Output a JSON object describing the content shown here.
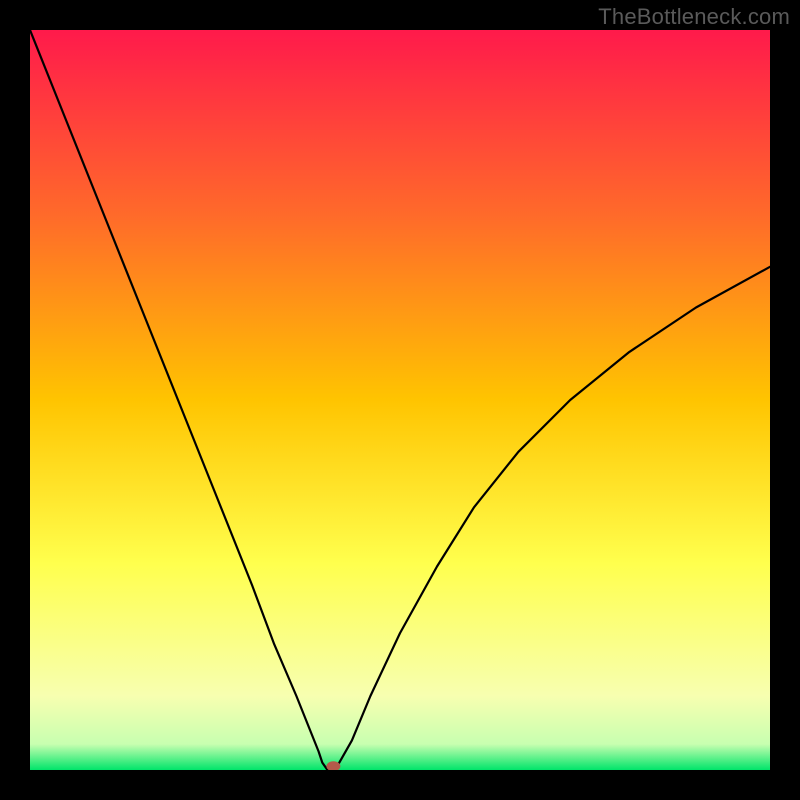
{
  "watermark": "TheBottleneck.com",
  "chart_data": {
    "type": "line",
    "title": "",
    "xlabel": "",
    "ylabel": "",
    "xlim": [
      0,
      100
    ],
    "ylim": [
      0,
      100
    ],
    "grid": false,
    "legend": false,
    "background_gradient": {
      "stops": [
        {
          "offset": 0.0,
          "color": "#ff1a4b"
        },
        {
          "offset": 0.25,
          "color": "#ff6a2a"
        },
        {
          "offset": 0.5,
          "color": "#ffc400"
        },
        {
          "offset": 0.72,
          "color": "#ffff4d"
        },
        {
          "offset": 0.9,
          "color": "#f7ffb0"
        },
        {
          "offset": 0.965,
          "color": "#c8ffb0"
        },
        {
          "offset": 1.0,
          "color": "#00e56a"
        }
      ]
    },
    "series": [
      {
        "name": "bottleneck-curve",
        "x": [
          0,
          5,
          10,
          15,
          20,
          25,
          30,
          33,
          36,
          38,
          39,
          39.5,
          40.2,
          41.0,
          41.8,
          43.5,
          46,
          50,
          55,
          60,
          66,
          73,
          81,
          90,
          100
        ],
        "y": [
          100,
          87.5,
          75,
          62.5,
          50,
          37.5,
          25,
          17,
          10,
          5,
          2.5,
          1.0,
          0.0,
          0.0,
          1.0,
          4.0,
          10,
          18.5,
          27.5,
          35.5,
          43,
          50,
          56.5,
          62.5,
          68
        ],
        "color": "#000000",
        "width": 2.2
      }
    ],
    "marker": {
      "name": "optimal-point",
      "x": 41,
      "y": 0.5,
      "color": "#b55a4a",
      "rx": 7,
      "ry": 5
    }
  }
}
